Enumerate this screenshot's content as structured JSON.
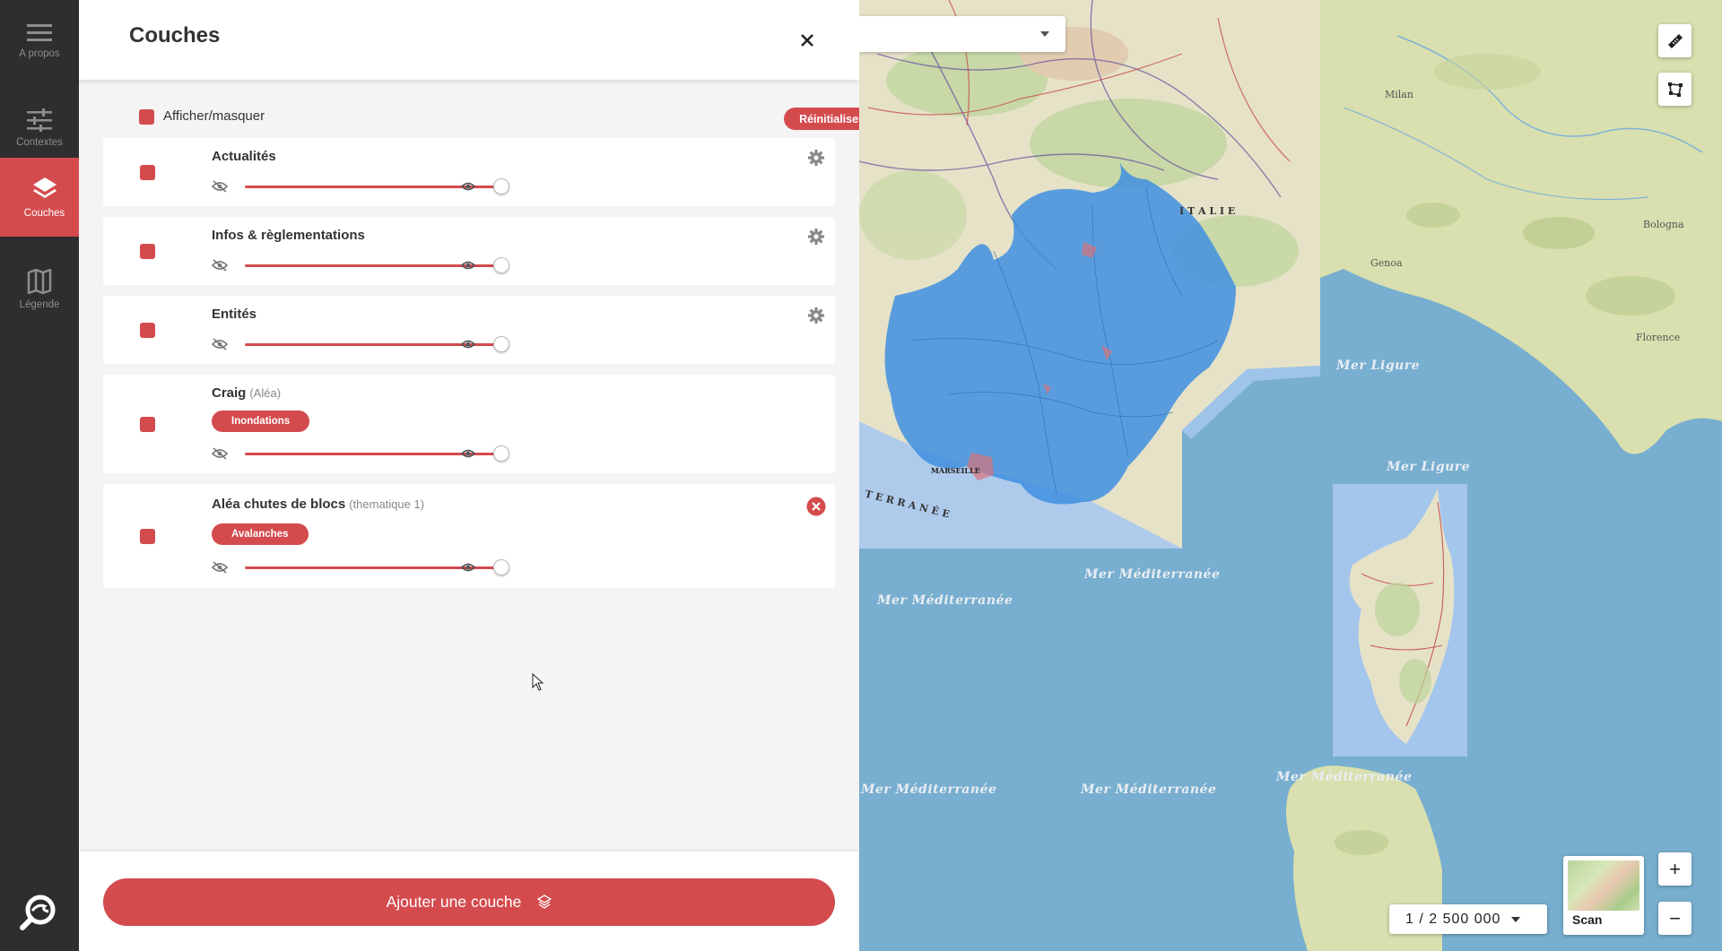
{
  "nav": {
    "items": [
      {
        "label": "A propos",
        "icon": "menu-icon"
      },
      {
        "label": "Contextes",
        "icon": "sliders-icon"
      },
      {
        "label": "Couches",
        "icon": "layers-icon"
      },
      {
        "label": "Légende",
        "icon": "map-book-icon"
      }
    ],
    "active": "Couches"
  },
  "panel": {
    "title": "Couches",
    "toggle_label": "Afficher/masquer",
    "reset_label": "Réinitialiser",
    "add_layer_label": "Ajouter une couche",
    "layers": [
      {
        "name": "Actualités",
        "sub": "",
        "tag": "",
        "opacity": 1.0,
        "action": "gear-icon"
      },
      {
        "name": "Infos & règlementations",
        "sub": "",
        "tag": "",
        "opacity": 1.0,
        "action": "gear-icon"
      },
      {
        "name": "Entités",
        "sub": "",
        "tag": "",
        "opacity": 1.0,
        "action": "gear-icon"
      },
      {
        "name": "Craig",
        "sub": "(Aléa)",
        "tag": "Inondations",
        "opacity": 1.0,
        "action": ""
      },
      {
        "name": "Aléa chutes de blocs",
        "sub": "(thematique 1)",
        "tag": "Avalanches",
        "opacity": 1.0,
        "action": "remove-icon"
      }
    ]
  },
  "map": {
    "scale": "1 / 2 500 000",
    "basemap_label": "Scan",
    "zoom_in": "+",
    "zoom_out": "−",
    "labels": {
      "mer_ligure_1": "Mer Ligure",
      "mer_ligure_2": "Mer Ligure",
      "mer_med_1": "Mer Méditerranée",
      "mer_med_2": "Mer Méditerranée",
      "mer_med_3": "Mer Méditerranée",
      "mer_med_4": "Mer Méditerranée",
      "mer_med_5": "Mer Méditerranée",
      "milan": "Milan",
      "genoa": "Genoa",
      "bologna": "Bologna",
      "florence": "Florence",
      "italie": "I T A L I E",
      "terranee": "T E R R A N É E",
      "marseille": "MARSEILLE"
    }
  },
  "colors": {
    "accent": "#d44b4e",
    "nav_bg": "#2e2e2e",
    "sea": "#78aecf",
    "land": "#d9dfae",
    "region": "#3f8fe0"
  }
}
